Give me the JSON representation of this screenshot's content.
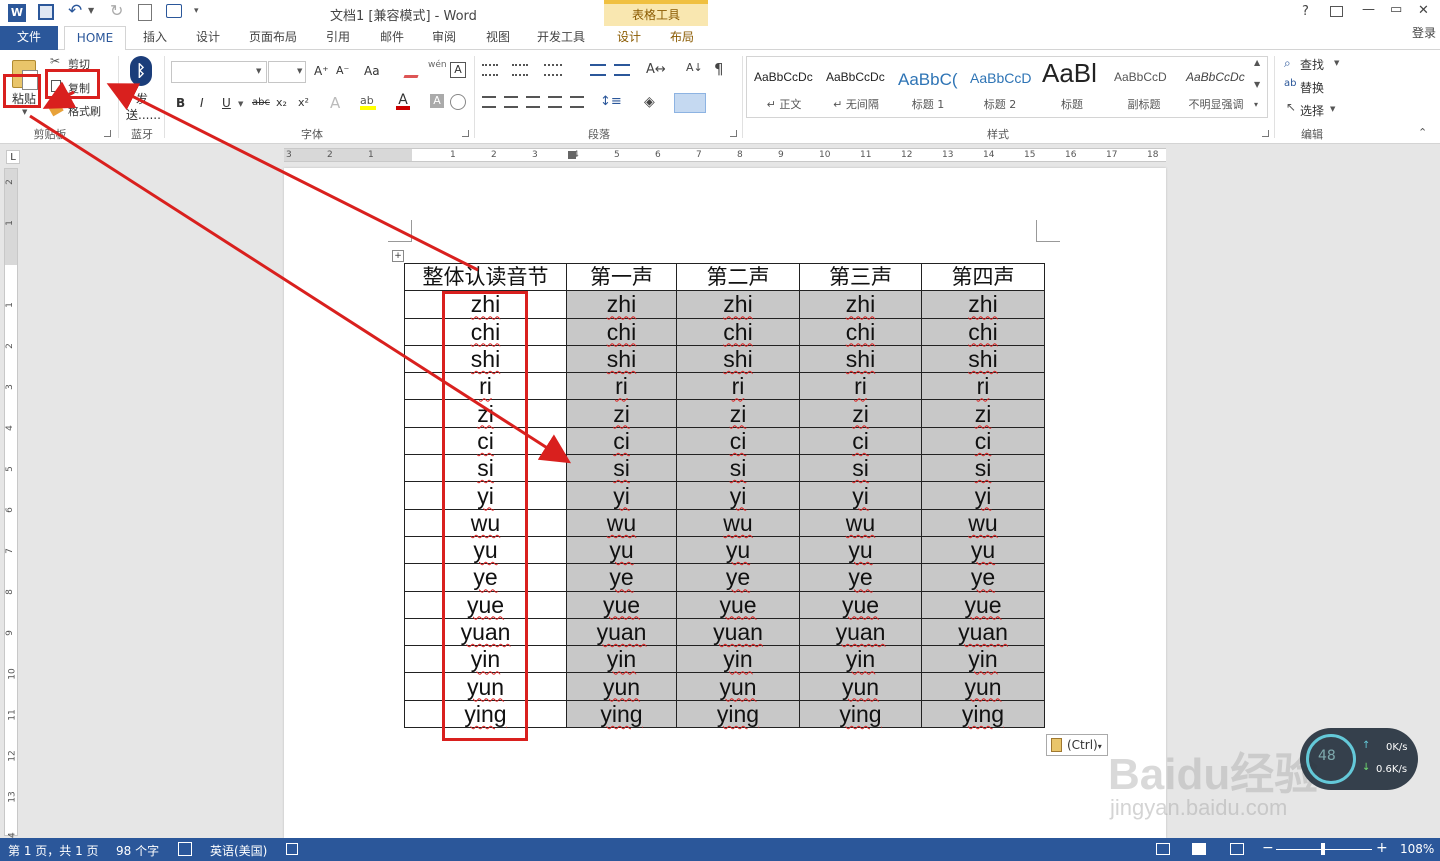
{
  "titlebar": {
    "title": "文档1 [兼容模式] - Word",
    "table_tools": "表格工具",
    "help": "?",
    "minimize": "—",
    "restore": "▭",
    "close": "✕",
    "undo_icon": "↶",
    "redo_icon": "↻"
  },
  "tabs": {
    "file": "文件",
    "home": "HOME",
    "insert": "插入",
    "design": "设计",
    "layout": "页面布局",
    "references": "引用",
    "mailings": "邮件",
    "review": "审阅",
    "view": "视图",
    "developer": "开发工具",
    "tbl_design": "设计",
    "tbl_layout": "布局",
    "login": "登录"
  },
  "ribbon": {
    "paste": "粘贴",
    "cut": "剪切",
    "copy": "复制",
    "format_painter": "格式刷",
    "clipboard": "剪贴板",
    "send_line1": "发",
    "send_line2": "送......",
    "bluetooth": "蓝牙",
    "font": "字体",
    "paragraph": "段落",
    "styles": "样式",
    "editing": "编辑",
    "find": "查找",
    "replace": "替换",
    "select": "选择",
    "font_buttons": [
      "B",
      "I",
      "U",
      "abc",
      "x₂",
      "x²"
    ],
    "grow_font": "A⁺",
    "shrink_font": "A⁻",
    "change_case": "Aa",
    "styles_list": [
      {
        "preview": "AaBbCcDc",
        "name": "↵ 正文"
      },
      {
        "preview": "AaBbCcDc",
        "name": "↵ 无间隔"
      },
      {
        "preview": "AaBbC(",
        "name": "标题 1"
      },
      {
        "preview": "AaBbCcD",
        "name": "标题 2"
      },
      {
        "preview": "AaBl",
        "name": "标题"
      },
      {
        "preview": "AaBbCcD",
        "name": "副标题"
      },
      {
        "preview": "AaBbCcDc",
        "name": "不明显强调"
      }
    ]
  },
  "ruler": {
    "h_ticks": [
      "3",
      "2",
      "1",
      "",
      "1",
      "2",
      "3",
      "4",
      "5",
      "6",
      "7",
      "8",
      "9",
      "10",
      "11",
      "12",
      "13",
      "14",
      "15",
      "16",
      "17",
      "18"
    ],
    "v_ticks": [
      "2",
      "1",
      "",
      "1",
      "2",
      "3",
      "4",
      "5",
      "6",
      "7",
      "8",
      "9",
      "10",
      "11",
      "12",
      "13",
      "14"
    ],
    "corner": "L"
  },
  "table": {
    "headers": [
      "整体认读音节",
      "第一声",
      "第二声",
      "第三声",
      "第四声"
    ],
    "syllables": [
      "zhi",
      "chi",
      "shi",
      "ri",
      "zi",
      "ci",
      "si",
      "yi",
      "wu",
      "yu",
      "ye",
      "yue",
      "yuan",
      "yin",
      "yun",
      "ying"
    ]
  },
  "paste_options": "(Ctrl)",
  "speed_widget": {
    "up": "0K/s",
    "down": "0.6K/s",
    "percent": "48"
  },
  "watermark": {
    "brand": "Baidu经验",
    "url": "jingyan.baidu.com"
  },
  "statusbar": {
    "page": "第 1 页，共 1 页",
    "words": "98 个字",
    "language": "英语(美国)",
    "zoom": "108%"
  },
  "colors": {
    "accent": "#2b579a",
    "annotation": "#d9201e",
    "selection": "#c8c8c8",
    "table_tools": "#f9dc8c"
  }
}
